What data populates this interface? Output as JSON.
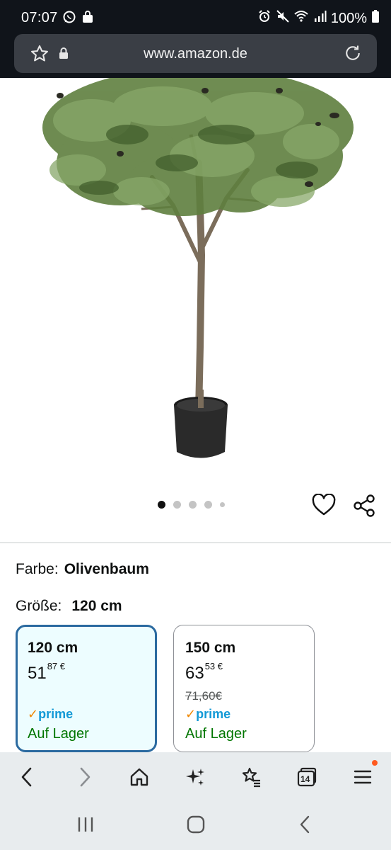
{
  "status_bar": {
    "time": "07:07",
    "battery": "100%",
    "left_icons": [
      "whatsapp-icon",
      "shopping-bag-icon"
    ],
    "right_icons": [
      "alarm-icon",
      "mute-icon",
      "wifi-icon",
      "signal-icon",
      "battery-icon"
    ]
  },
  "browser": {
    "url": "www.amazon.de",
    "open_tabs": "14"
  },
  "carousel": {
    "dot_count": 5,
    "active_index": 0
  },
  "product": {
    "color_label": "Farbe:",
    "color_value": "Olivenbaum",
    "size_label": "Größe:",
    "size_value": "120 cm"
  },
  "size_options": [
    {
      "size": "120 cm",
      "price_whole": "51",
      "price_fraction": "87",
      "currency": "€",
      "old_price": "",
      "prime": "prime",
      "stock": "Auf Lager",
      "selected": true
    },
    {
      "size": "150 cm",
      "price_whole": "63",
      "price_fraction": "53",
      "currency": "€",
      "old_price": "71,60€",
      "prime": "prime",
      "stock": "Auf Lager",
      "selected": false
    }
  ],
  "colors": {
    "status_bar_bg": "#10141a",
    "url_box_bg": "#3a3e45",
    "selected_border": "#2b6aa0",
    "selected_bg": "#edfdff",
    "prime_blue": "#1399d6",
    "prime_check": "#f08804",
    "in_stock_green": "#007600",
    "toolbar_bg": "#e8ecee"
  }
}
